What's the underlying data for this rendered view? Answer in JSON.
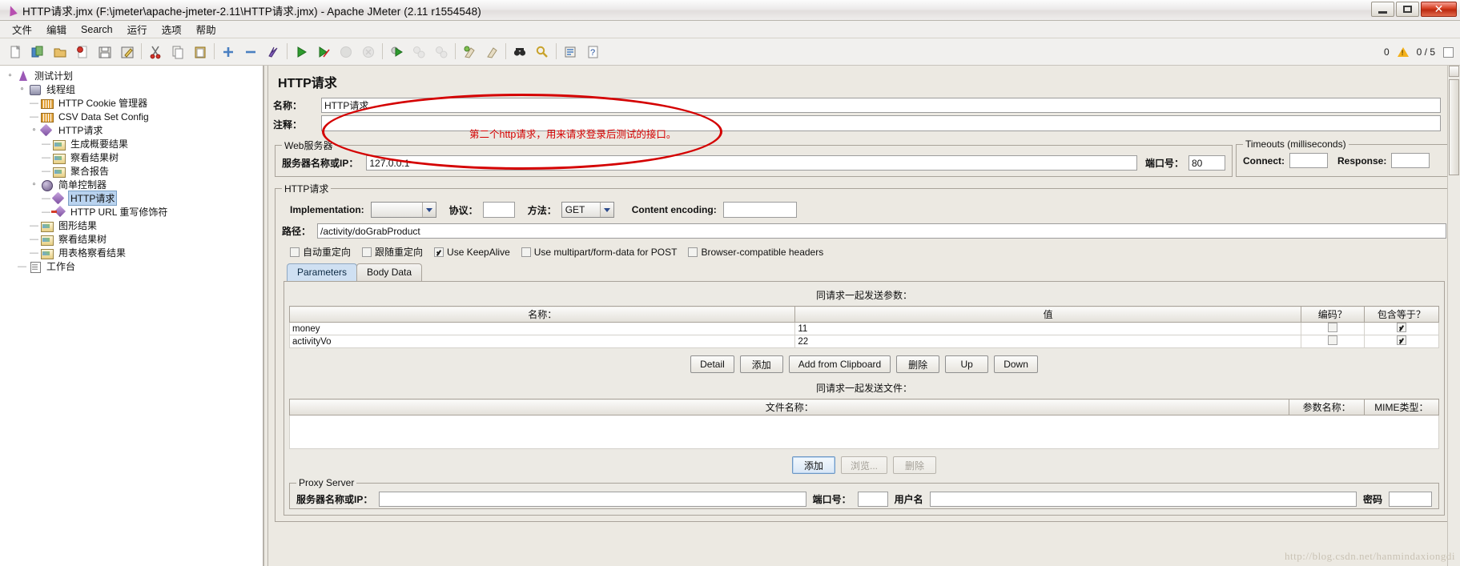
{
  "window": {
    "title": "HTTP请求.jmx (F:\\jmeter\\apache-jmeter-2.11\\HTTP请求.jmx) - Apache JMeter (2.11 r1554548)",
    "minimize_label": "Minimize",
    "maximize_label": "Maximize",
    "close_label": "✕"
  },
  "menubar": {
    "items": [
      {
        "label": "文件"
      },
      {
        "label": "编辑"
      },
      {
        "label": "Search"
      },
      {
        "label": "运行"
      },
      {
        "label": "选项"
      },
      {
        "label": "帮助"
      }
    ]
  },
  "toolbar": {
    "buttons": [
      {
        "name": "new-icon"
      },
      {
        "name": "templates-icon"
      },
      {
        "name": "open-icon"
      },
      {
        "name": "close-icon"
      },
      {
        "name": "save-icon"
      },
      {
        "name": "save-as-icon"
      },
      {
        "name": "cut-icon"
      },
      {
        "name": "copy-icon"
      },
      {
        "name": "paste-icon"
      },
      {
        "name": "expand-icon"
      },
      {
        "name": "collapse-icon"
      },
      {
        "name": "toggle-icon"
      },
      {
        "name": "start-icon"
      },
      {
        "name": "start-no-pauses-icon"
      },
      {
        "name": "stop-icon"
      },
      {
        "name": "shutdown-icon"
      },
      {
        "name": "clear-icon"
      },
      {
        "name": "clear-all-icon"
      },
      {
        "name": "remote-start-icon"
      },
      {
        "name": "remote-start-all-icon"
      },
      {
        "name": "remote-stop-all-icon"
      },
      {
        "name": "search-icon"
      },
      {
        "name": "search-reset-icon"
      },
      {
        "name": "function-helper-icon"
      },
      {
        "name": "help-icon"
      }
    ],
    "warning_count": "0",
    "running_count": "0 / 5"
  },
  "tree": {
    "nodes": [
      {
        "label": "测试计划",
        "icon": "flask-icon",
        "depth": 0,
        "expander": "open",
        "selected": false
      },
      {
        "label": "线程组",
        "icon": "thread-group-icon",
        "depth": 1,
        "expander": "open",
        "selected": false
      },
      {
        "label": "HTTP Cookie 管理器",
        "icon": "cookie-manager-icon",
        "depth": 2,
        "expander": "leaf",
        "selected": false
      },
      {
        "label": "CSV Data Set Config",
        "icon": "csv-config-icon",
        "depth": 2,
        "expander": "leaf",
        "selected": false
      },
      {
        "label": "HTTP请求",
        "icon": "http-sampler-icon",
        "depth": 2,
        "expander": "open",
        "selected": false
      },
      {
        "label": "生成概要结果",
        "icon": "listener-icon",
        "depth": 3,
        "expander": "leaf",
        "selected": false
      },
      {
        "label": "察看结果树",
        "icon": "listener-icon",
        "depth": 3,
        "expander": "leaf",
        "selected": false
      },
      {
        "label": "聚合报告",
        "icon": "listener-icon",
        "depth": 3,
        "expander": "leaf",
        "selected": false
      },
      {
        "label": "简单控制器",
        "icon": "controller-icon",
        "depth": 2,
        "expander": "open",
        "selected": false
      },
      {
        "label": "HTTP请求",
        "icon": "http-sampler-icon",
        "depth": 3,
        "expander": "leaf",
        "selected": true
      },
      {
        "label": "HTTP URL 重写修饰符",
        "icon": "url-rewriting-icon",
        "depth": 3,
        "expander": "leaf",
        "selected": false
      },
      {
        "label": "图形结果",
        "icon": "listener-icon",
        "depth": 2,
        "expander": "leaf",
        "selected": false
      },
      {
        "label": "察看结果树",
        "icon": "listener-icon",
        "depth": 2,
        "expander": "leaf",
        "selected": false
      },
      {
        "label": "用表格察看结果",
        "icon": "listener-icon",
        "depth": 2,
        "expander": "leaf",
        "selected": false
      },
      {
        "label": "工作台",
        "icon": "workbench-icon",
        "depth": 1,
        "expander": "leaf",
        "selected": false
      }
    ]
  },
  "main": {
    "panel_title": "HTTP请求",
    "name_label": "名称：",
    "name_value": "HTTP请求",
    "comment_label": "注释：",
    "comment_value": "",
    "webserver": {
      "legend": "Web服务器",
      "host_label": "服务器名称或IP：",
      "host_value": "127.0.0.1",
      "port_label": "端口号：",
      "port_value": "80"
    },
    "timeouts": {
      "legend": "Timeouts (milliseconds)",
      "connect_label": "Connect:",
      "connect_value": "",
      "response_label": "Response:",
      "response_value": ""
    },
    "httprequest": {
      "legend": "HTTP请求",
      "implementation_label": "Implementation:",
      "implementation_value": "",
      "protocol_label": "协议：",
      "protocol_value": "",
      "method_label": "方法：",
      "method_value": "GET",
      "content_encoding_label": "Content encoding:",
      "content_encoding_value": "",
      "path_label": "路径：",
      "path_value": "/activity/doGrabProduct",
      "checkboxes": [
        {
          "label": "自动重定向",
          "checked": false
        },
        {
          "label": "跟随重定向",
          "checked": false
        },
        {
          "label": "Use KeepAlive",
          "checked": true
        },
        {
          "label": "Use multipart/form-data for POST",
          "checked": false
        },
        {
          "label": "Browser-compatible headers",
          "checked": false
        }
      ]
    },
    "tabs": [
      {
        "label": "Parameters",
        "active": true
      },
      {
        "label": "Body Data",
        "active": false
      }
    ],
    "params": {
      "caption": "同请求一起发送参数：",
      "columns": [
        "名称：",
        "值",
        "编码？",
        "包含等于？"
      ],
      "rows": [
        {
          "name": "money",
          "value": "11",
          "encode": false,
          "include_equals": true
        },
        {
          "name": "activityVo",
          "value": "22",
          "encode": false,
          "include_equals": true
        }
      ],
      "buttons": [
        {
          "label": "Detail",
          "state": "normal"
        },
        {
          "label": "添加",
          "state": "normal"
        },
        {
          "label": "Add from Clipboard",
          "state": "normal"
        },
        {
          "label": "删除",
          "state": "normal"
        },
        {
          "label": "Up",
          "state": "normal"
        },
        {
          "label": "Down",
          "state": "normal"
        }
      ]
    },
    "files": {
      "caption": "同请求一起发送文件：",
      "columns": [
        "文件名称：",
        "参数名称：",
        "MIME类型："
      ],
      "rows": [],
      "buttons": [
        {
          "label": "添加",
          "state": "focus"
        },
        {
          "label": "浏览...",
          "state": "disabled"
        },
        {
          "label": "删除",
          "state": "disabled"
        }
      ]
    },
    "proxy": {
      "legend": "Proxy Server",
      "host_label": "服务器名称或IP：",
      "host_value": "",
      "port_label": "端口号：",
      "port_value": "",
      "username_label": "用户名",
      "username_value": "",
      "password_label": "密码",
      "password_value": ""
    }
  },
  "annotation": {
    "text": "第二个http请求，用来请求登录后测试的接口。",
    "color": "#d40000"
  },
  "watermark": "http://blog.csdn.net/hanmindaxiongdi"
}
